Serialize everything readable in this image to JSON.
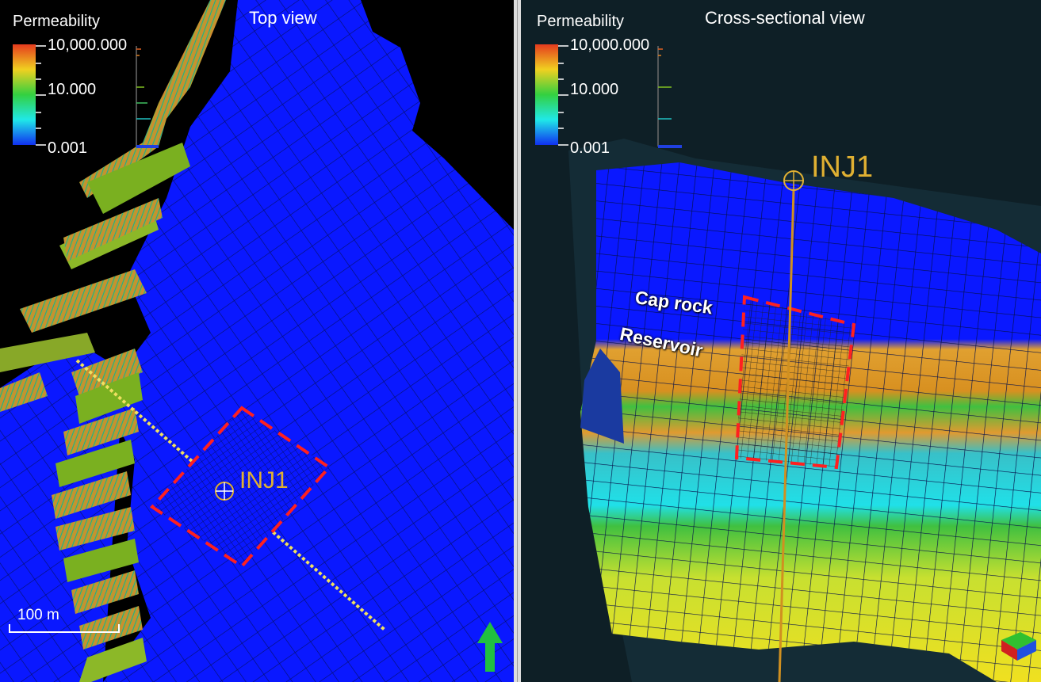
{
  "left_panel": {
    "title": "Top view",
    "legend": {
      "title": "Permeability",
      "ticks": [
        "10,000.000",
        "10.000",
        "0.001"
      ],
      "colors": [
        "#e53a1e",
        "#f0d020",
        "#33d040",
        "#20e8e8",
        "#1030f0"
      ]
    },
    "well_label": "INJ1",
    "scale_bar_label": "100 m",
    "north_arrow_icon": "up-arrow-icon"
  },
  "right_panel": {
    "title": "Cross-sectional view",
    "legend": {
      "title": "Permeability",
      "ticks": [
        "10,000.000",
        "10.000",
        "0.001"
      ],
      "colors": [
        "#e53a1e",
        "#f0d020",
        "#33d040",
        "#20e8e8",
        "#1030f0"
      ]
    },
    "well_label": "INJ1",
    "layer_labels": {
      "cap_rock": "Cap rock",
      "reservoir": "Reservoir"
    },
    "orientation_icon": "axis-cube-icon"
  },
  "colors": {
    "grid_blue": "#0a18ff",
    "well_gold": "#e0b032",
    "highlight_red": "#ff2020",
    "section_line": "#f0e060"
  }
}
